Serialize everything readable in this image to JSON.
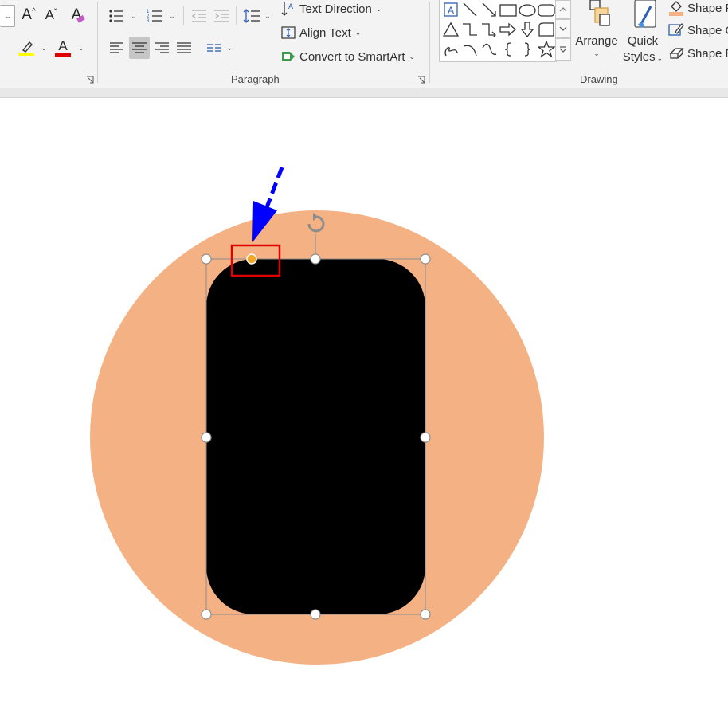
{
  "ribbon": {
    "font_group": {
      "grow_font": "A",
      "shrink_font": "A",
      "clear_formatting": "A",
      "highlight_color": "#ffff00",
      "font_color": "#e00000"
    },
    "paragraph": {
      "label": "Paragraph",
      "text_direction": "Text Direction",
      "align_text": "Align Text",
      "convert_smartart": "Convert to SmartArt"
    },
    "drawing": {
      "label": "Drawing",
      "arrange": "Arrange",
      "quick_styles_line1": "Quick",
      "quick_styles_line2": "Styles",
      "shape_fill": "Shape Fill",
      "shape_outline": "Shape Outline",
      "shape_effects": "Shape Effects",
      "shape_fill_color": "#f4b183"
    }
  },
  "slide": {
    "circle_color": "#f4b183",
    "rectangle_color": "#000000",
    "arrow_color": "#0000ff",
    "highlight_box_color": "#e00000",
    "adjust_handle_color": "#f5a623"
  }
}
